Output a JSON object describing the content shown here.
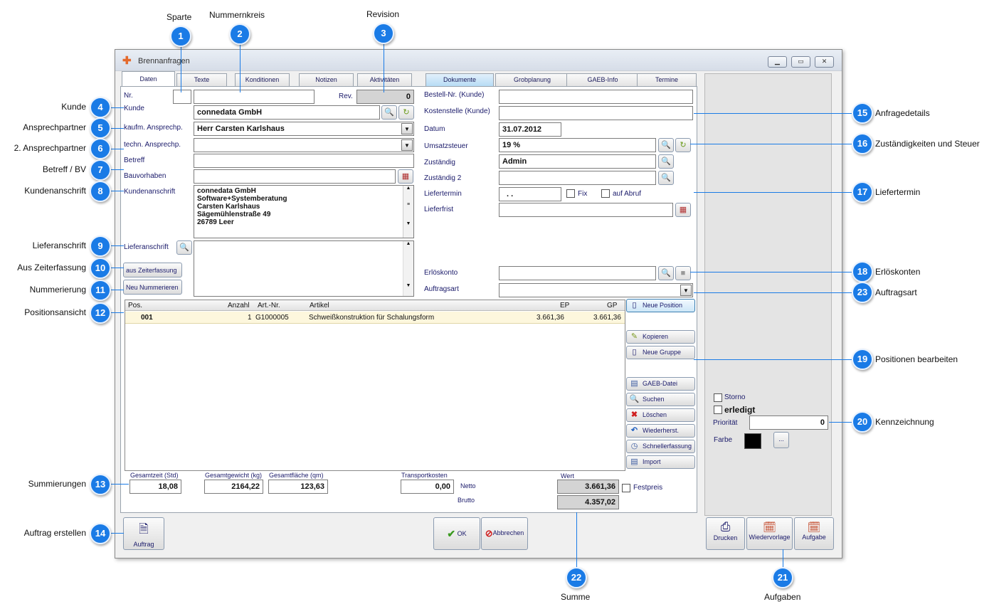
{
  "window": {
    "title": "Brennanfragen"
  },
  "tabs": [
    "Daten",
    "Texte",
    "Konditionen",
    "Notizen",
    "Aktivitäten",
    "Dokumente",
    "Grobplanung",
    "GAEB-Info",
    "Termine"
  ],
  "left": {
    "nr_label": "Nr.",
    "rev_label": "Rev.",
    "rev_value": "0",
    "kunde_label": "Kunde",
    "kunde_value": "connedata GmbH",
    "kaufm_label": "kaufm. Ansprechp.",
    "kaufm_value": "Herr Carsten Karlshaus",
    "techn_label": "techn. Ansprechp.",
    "betreff_label": "Betreff",
    "bauvorhaben_label": "Bauvorhaben",
    "kundenanschrift_label": "Kundenanschrift",
    "address": [
      "connedata GmbH",
      "Software+Systemberatung",
      "Carsten Karlshaus",
      "Sägemühlenstraße 49",
      "26789 Leer"
    ],
    "lieferanschrift_label": "Lieferanschrift",
    "zeiterfassung_button": "aus Zeiterfassung",
    "nummerieren_button": "Neu Nummerieren"
  },
  "right": {
    "bestell_label": "Bestell-Nr. (Kunde)",
    "kostenstelle_label": "Kostenstelle (Kunde)",
    "datum_label": "Datum",
    "datum_value": "31.07.2012",
    "ust_label": "Umsatzsteuer",
    "ust_value": "19 %",
    "zustaendig_label": "Zuständig",
    "zustaendig_value": "Admin",
    "zustaendig2_label": "Zuständig 2",
    "liefertermin_label": "Liefertermin",
    "liefertermin_value": ". .",
    "fix_label": "Fix",
    "abruf_label": "auf Abruf",
    "lieferfrist_label": "Lieferfrist",
    "erloeskonto_label": "Erlöskonto",
    "auftragsart_label": "Auftragsart"
  },
  "positions": {
    "headers": {
      "pos": "Pos.",
      "anzahl": "Anzahl",
      "artnr": "Art.-Nr.",
      "artikel": "Artikel",
      "ep": "EP",
      "gp": "GP"
    },
    "rows": [
      {
        "pos": "001",
        "anzahl": "1",
        "artnr": "G1000005",
        "artikel": "Schweißkonstruktion für Schalungsform",
        "ep": "3.661,36",
        "gp": "3.661,36"
      }
    ]
  },
  "position_buttons": {
    "neue_position": "Neue Position",
    "kopieren": "Kopieren",
    "neue_gruppe": "Neue Gruppe",
    "gaeb": "GAEB-Datei",
    "suchen": "Suchen",
    "loeschen": "Löschen",
    "wiederherst": "Wiederherst.",
    "schnell": "Schnellerfassung",
    "import": "Import"
  },
  "totals": {
    "zeit_label": "Gesamtzeit (Std)",
    "zeit_value": "18,08",
    "gewicht_label": "Gesamtgewicht (kg)",
    "gewicht_value": "2164,22",
    "flaeche_label": "Gesamtfläche (qm)",
    "flaeche_value": "123,63",
    "transport_label": "Transportkosten",
    "transport_value": "0,00",
    "wert_label": "Wert",
    "netto_label": "Netto",
    "netto_value": "3.661,36",
    "brutto_label": "Brutto",
    "brutto_value": "4.357,02",
    "festpreis_label": "Festpreis"
  },
  "side": {
    "storno_label": "Storno",
    "erledigt_label": "erledigt",
    "prioritaet_label": "Priorität",
    "prioritaet_value": "0",
    "farbe_label": "Farbe",
    "farbe_color": "#000000",
    "ellipsis": "..."
  },
  "bottom": {
    "auftrag": "Auftrag",
    "ok": "OK",
    "abbrechen": "Abbrechen",
    "drucken": "Drucken",
    "wiedervorlage": "Wiedervorlage",
    "aufgabe": "Aufgabe"
  },
  "callouts": [
    {
      "n": "1",
      "label": "Sparte"
    },
    {
      "n": "2",
      "label": "Nummernkreis"
    },
    {
      "n": "3",
      "label": "Revision"
    },
    {
      "n": "4",
      "label": "Kunde"
    },
    {
      "n": "5",
      "label": "Ansprechpartner"
    },
    {
      "n": "6",
      "label": "2. Ansprechpartner"
    },
    {
      "n": "7",
      "label": "Betreff / BV"
    },
    {
      "n": "8",
      "label": "Kundenanschrift"
    },
    {
      "n": "9",
      "label": "Lieferanschrift"
    },
    {
      "n": "10",
      "label": "Aus Zeiterfassung"
    },
    {
      "n": "11",
      "label": "Nummerierung"
    },
    {
      "n": "12",
      "label": "Positionsansicht"
    },
    {
      "n": "13",
      "label": "Summierungen"
    },
    {
      "n": "14",
      "label": "Auftrag erstellen"
    },
    {
      "n": "15",
      "label": "Anfragedetails"
    },
    {
      "n": "16",
      "label": "Zuständigkeiten und Steuer"
    },
    {
      "n": "17",
      "label": "Liefertermin"
    },
    {
      "n": "18",
      "label": "Erlöskonten"
    },
    {
      "n": "19",
      "label": "Positionen bearbeiten"
    },
    {
      "n": "20",
      "label": "Kennzeichnung"
    },
    {
      "n": "21",
      "label": "Aufgaben"
    },
    {
      "n": "22",
      "label": "Summe"
    },
    {
      "n": "23",
      "label": "Auftragsart"
    }
  ]
}
